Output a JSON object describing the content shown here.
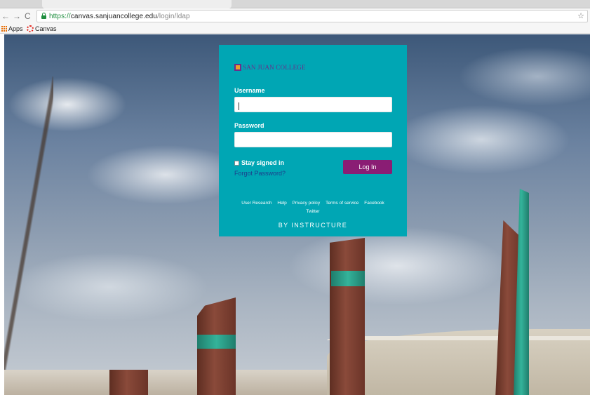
{
  "browser": {
    "url_scheme": "https://",
    "url_host": "canvas.sanjuancollege.edu",
    "url_path": "/login/ldap",
    "back_icon": "back-arrow-icon",
    "forward_icon": "forward-arrow-icon",
    "reload_icon": "reload-icon",
    "back_glyph": "←",
    "forward_glyph": "→",
    "reload_glyph": "C",
    "star_glyph": "☆"
  },
  "bookmarks": {
    "apps_label": "Apps",
    "canvas_label": "Canvas"
  },
  "login": {
    "brand_name": "SAN JUAN COLLEGE",
    "username_label": "Username",
    "username_value": "",
    "password_label": "Password",
    "password_value": "",
    "stay_signed_in_label": "Stay signed in",
    "forgot_password_label": "Forgot Password?",
    "login_button_label": "Log In",
    "footer_links": [
      "User Research",
      "Help",
      "Privacy policy",
      "Terms of service",
      "Facebook",
      "Twitter"
    ],
    "powered_by": "BY INSTRUCTURE"
  },
  "colors": {
    "card_background": "#00a6b4",
    "login_button": "#8a1d74",
    "brand_purple": "#6a2f8a",
    "link_blue": "#1c3f8c",
    "secure_green": "#1e8e3e"
  }
}
